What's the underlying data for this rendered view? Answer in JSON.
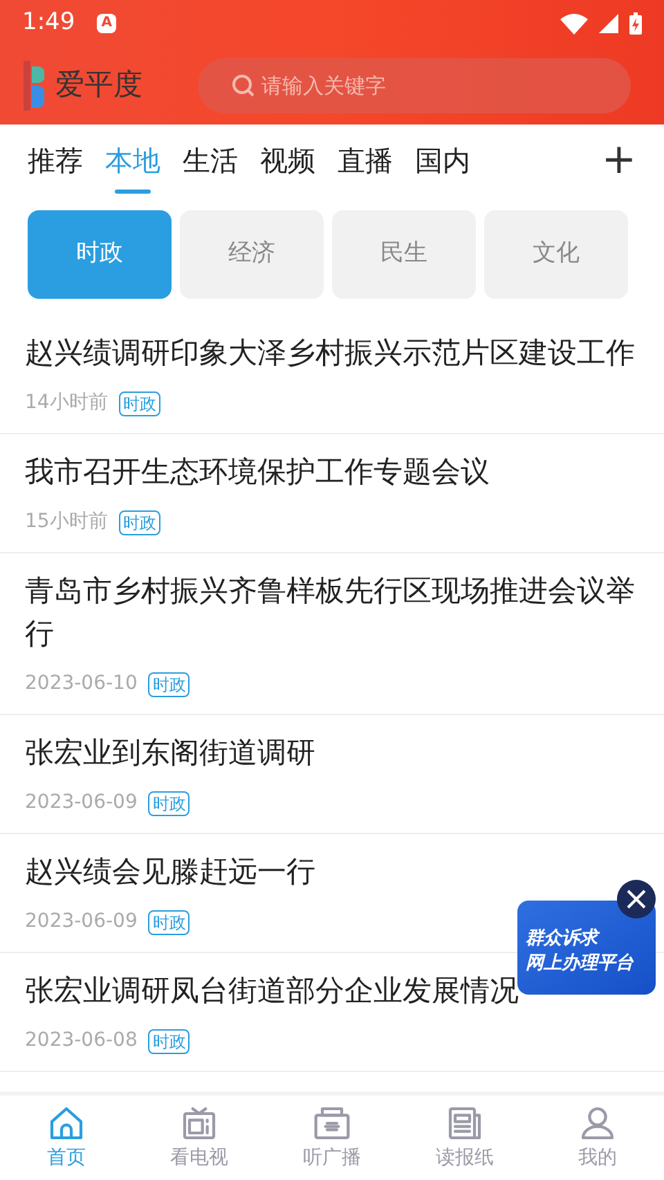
{
  "status_bar": {
    "time": "1:49",
    "badge": "A"
  },
  "header": {
    "logo_text": "爱平度",
    "search": {
      "placeholder": "请输入关键字"
    }
  },
  "channels": [
    {
      "label": "推荐",
      "selected": false
    },
    {
      "label": "本地",
      "selected": true
    },
    {
      "label": "生活",
      "selected": false
    },
    {
      "label": "视频",
      "selected": false
    },
    {
      "label": "直播",
      "selected": false
    },
    {
      "label": "国内",
      "selected": false
    }
  ],
  "add_button": "+",
  "categories": [
    {
      "label": "时政",
      "selected": true
    },
    {
      "label": "经济",
      "selected": false
    },
    {
      "label": "民生",
      "selected": false
    },
    {
      "label": "文化",
      "selected": false
    }
  ],
  "news": [
    {
      "title": "赵兴绩调研印象大泽乡村振兴示范片区建设工作",
      "time": "14小时前",
      "tag": "时政"
    },
    {
      "title": "我市召开生态环境保护工作专题会议",
      "time": "15小时前",
      "tag": "时政"
    },
    {
      "title": "青岛市乡村振兴齐鲁样板先行区现场推进会议举行",
      "time": "2023-06-10",
      "tag": "时政"
    },
    {
      "title": "张宏业到东阁街道调研",
      "time": "2023-06-09",
      "tag": "时政"
    },
    {
      "title": "赵兴绩会见滕赶远一行",
      "time": "2023-06-09",
      "tag": "时政"
    },
    {
      "title": "张宏业调研凤台街道部分企业发展情况",
      "time": "2023-06-08",
      "tag": "时政"
    }
  ],
  "floating_banner": {
    "lines": [
      "群众诉求",
      "网上办理平台"
    ]
  },
  "bottom_nav": [
    {
      "label": "首页",
      "kind": "home",
      "selected": true
    },
    {
      "label": "看电视",
      "kind": "tv",
      "selected": false
    },
    {
      "label": "听广播",
      "kind": "radio",
      "selected": false
    },
    {
      "label": "读报纸",
      "kind": "newspaper",
      "selected": false
    },
    {
      "label": "我的",
      "kind": "user",
      "selected": false
    }
  ]
}
